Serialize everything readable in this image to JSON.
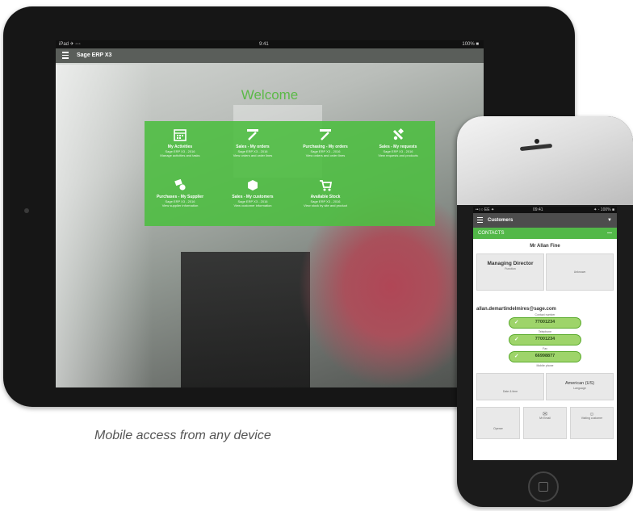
{
  "caption": "Mobile access from any device",
  "colors": {
    "accent_green": "#4fbe43",
    "welcome_green": "#5cb948",
    "pill_green": "#9ed46a"
  },
  "tablet": {
    "status": {
      "left": "iPad ✈ ◦◦◦",
      "center": "9:41",
      "right": "100% ■"
    },
    "app_title": "Sage ERP X3",
    "welcome": "Welcome",
    "tiles": [
      {
        "icon": "calendar-icon",
        "title": "My Activities",
        "sub1": "Sage ERP X3 - 2016",
        "sub2": "Manage activities and tasks"
      },
      {
        "icon": "pen-icon",
        "title": "Sales - My orders",
        "sub1": "Sage ERP X3 - 2016",
        "sub2": "View orders and order lines"
      },
      {
        "icon": "pen-icon",
        "title": "Purchasing - My orders",
        "sub1": "Sage ERP X3 - 2016",
        "sub2": "View orders and order lines"
      },
      {
        "icon": "tools-icon",
        "title": "Sales - My requests",
        "sub1": "Sage ERP X3 - 2016",
        "sub2": "View requests and products"
      },
      {
        "icon": "handshake-icon",
        "title": "Purchases - My Supplier",
        "sub1": "Sage ERP X3 - 2016",
        "sub2": "View supplier information"
      },
      {
        "icon": "box-icon",
        "title": "Sales - My customers",
        "sub1": "Sage ERP X3 - 2016",
        "sub2": "View customer information"
      },
      {
        "icon": "cart-icon",
        "title": "Available Stock",
        "sub1": "Sage ERP X3 - 2016",
        "sub2": "View stock by site and product"
      }
    ]
  },
  "phone": {
    "status": {
      "left": "••○○ EE ✦",
      "center": "09:41",
      "right": "✦ ◦ 100% ■"
    },
    "app_title": "Customers",
    "section": "CONTACTS",
    "contact_name": "Mr Allan Fine",
    "role": {
      "title": "Managing Director",
      "label": "Function"
    },
    "role_right": "Unknown",
    "email": "allan.demartindelmires@sage.com",
    "phones": [
      {
        "label": "Contact number",
        "value": "77001234"
      },
      {
        "label": "Telephone",
        "value": "77001234"
      },
      {
        "label": "Fax",
        "value": "66998877"
      }
    ],
    "mobile_label": "Mobile phone",
    "left_box": "Date & time",
    "language": {
      "title": "American (US)",
      "label": "Language"
    },
    "actions": [
      {
        "icon": "phone-icon",
        "label": "Opener"
      },
      {
        "icon": "email-icon",
        "label": "Mr Email"
      },
      {
        "icon": "person-icon",
        "label": "Visiting customer"
      }
    ]
  }
}
